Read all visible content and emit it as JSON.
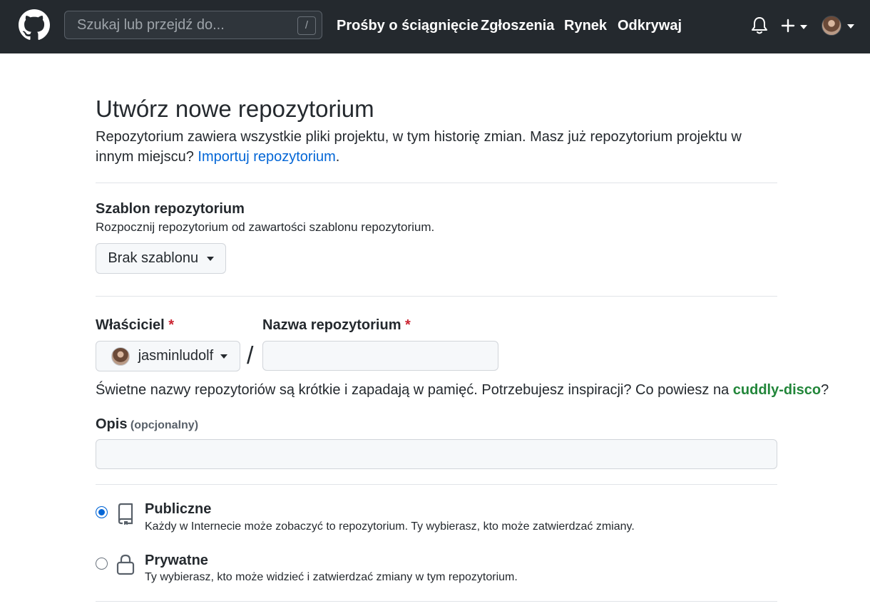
{
  "header": {
    "search_placeholder": "Szukaj lub przejdź do...",
    "search_shortcut": "/",
    "nav": [
      "Prośby o ściągnięcie",
      "Zgłoszenia",
      "Rynek",
      "Odkrywaj"
    ]
  },
  "page": {
    "title": "Utwórz nowe repozytorium",
    "intro_text": "Repozytorium zawiera wszystkie pliki projektu, w tym historię zmian. Masz już repozytorium projektu w innym miejscu?",
    "import_link": "Importuj repozytorium",
    "intro_end": "."
  },
  "template": {
    "label": "Szablon repozytorium",
    "description": "Rozpocznij repozytorium od zawartości szablonu repozytorium.",
    "selected": "Brak szablonu"
  },
  "owner": {
    "label": "Właściciel",
    "required_mark": "*",
    "value": "jasminludolf",
    "separator": "/"
  },
  "repo_name": {
    "label": "Nazwa repozytorium",
    "required_mark": "*",
    "value": ""
  },
  "hint": {
    "text": "Świetne nazwy repozytoriów są krótkie i zapadają w pamięć. Potrzebujesz inspiracji? Co powiesz na",
    "suggestion": "cuddly-disco",
    "end": "?"
  },
  "description_field": {
    "label": "Opis",
    "optional": "(opcjonalny)",
    "value": ""
  },
  "visibility": [
    {
      "title": "Publiczne",
      "description": "Każdy w Internecie może zobaczyć to repozytorium. Ty wybierasz, kto może zatwierdzać zmiany.",
      "checked": true,
      "icon": "repo-icon"
    },
    {
      "title": "Prywatne",
      "description": "Ty wybierasz, kto może widzieć i zatwierdzać zmiany w tym repozytorium.",
      "checked": false,
      "icon": "lock-icon"
    }
  ],
  "colors": {
    "header_bg": "#24292e",
    "link": "#0366d6",
    "suggestion": "#22863a",
    "required": "#cb2431"
  }
}
